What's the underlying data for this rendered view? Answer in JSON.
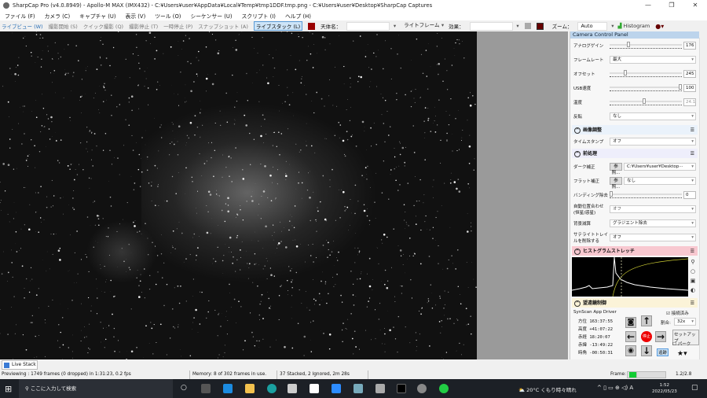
{
  "title": "SharpCap Pro (v4.0.8949) - Apollo-M MAX (IMX432) - C:¥Users¥user¥AppData¥Local¥Temp¥tmp1DDF.tmp.png - C:¥Users¥user¥Desktop¥SharpCap Captures",
  "menu": [
    "ファイル (F)",
    "カメラ (C)",
    "キャプチャ (U)",
    "表示 (V)",
    "ツール (O)",
    "シーケンサー (U)",
    "スクリプト (I)",
    "ヘルプ (H)"
  ],
  "toolbar": {
    "live_view": "ライブビュー (W)",
    "start_capture": "撮影開始 (S)",
    "quick_capture": "クイック撮影 (Q)",
    "stop_capture": "撮影停止 (T)",
    "pause": "一時停止 (P)",
    "snapshot": "スナップショット (A)",
    "live_stack": "ライブスタック (L)",
    "target_label": "天体名：",
    "target_value": "",
    "frame_type": "ライトフレーム",
    "effect_label": "効果：",
    "effect_value": "",
    "zoom_label": "ズーム：",
    "zoom_value": "Auto",
    "histogram": "Histogram"
  },
  "panel": {
    "title": "Camera Control Panel",
    "camera": {
      "gain_label": "アナログゲイン",
      "gain": "176",
      "gain_frac": 0.28,
      "framerate_label": "フレームレート",
      "framerate": "最大",
      "offset_label": "オフセット",
      "offset": "245",
      "offset_frac": 0.24,
      "usb_label": "USB速度",
      "usb": "100",
      "usb_frac": 1.0,
      "temp_label": "温度",
      "temp": "24.1",
      "temp_frac": 0.5,
      "flip_label": "反転",
      "flip": "なし"
    },
    "image_adjust": {
      "title": "画像調整",
      "timestamp_label": "タイムスタンプ",
      "timestamp": "オフ"
    },
    "preprocess": {
      "title": "前処理",
      "dark_label": "ダーク補正",
      "dark_btn": "参照...",
      "dark": "C:¥Users¥user¥Desktop···",
      "flat_label": "フラット補正",
      "flat_btn": "参照...",
      "flat": "なし",
      "banding_label": "バンディング除去",
      "banding": "0",
      "align_label": "自動位置合わせ (恒星/惑星)",
      "align": "オフ",
      "bg_label": "背景減算",
      "bg": "グラジエント除去",
      "sat_label": "サテライトトレイルを削除する",
      "sat": "オフ"
    },
    "histogram": {
      "title": "ヒストグラムストレッチ"
    },
    "telescope": {
      "title": "望遠鏡制御",
      "driver": "SynScan App Driver",
      "connected": "接続済み",
      "rate_label": "割合:",
      "rate": "32x",
      "setup": "セットアップ",
      "park": "パーク",
      "stop": "停止",
      "track": "追跡",
      "coords": [
        {
          "label": "方位",
          "value": "163:37:55"
        },
        {
          "label": "高度",
          "value": "+41:07:22"
        },
        {
          "label": "赤経",
          "value": "18:20:07"
        },
        {
          "label": "赤緯",
          "value": "-13:49:22"
        },
        {
          "label": "時角",
          "value": "-00:50:31"
        }
      ]
    }
  },
  "livestack_tab": "Live Stack",
  "status": {
    "preview": "Previewing : 1749 frames (0 dropped) in 1:31:23, 0.2 fps",
    "memory": "Memory: 8 of 302 frames in use.",
    "stacked": "37 Stacked, 2 Ignored, 2m 28s",
    "frame_label": "Frame:",
    "frame_value": "1.2/2.8",
    "frame_frac": 0.2
  },
  "taskbar": {
    "search": "ここに入力して検索",
    "weather": "20°C くもり時々晴れ",
    "time": "1:52",
    "date": "2022/05/23"
  }
}
